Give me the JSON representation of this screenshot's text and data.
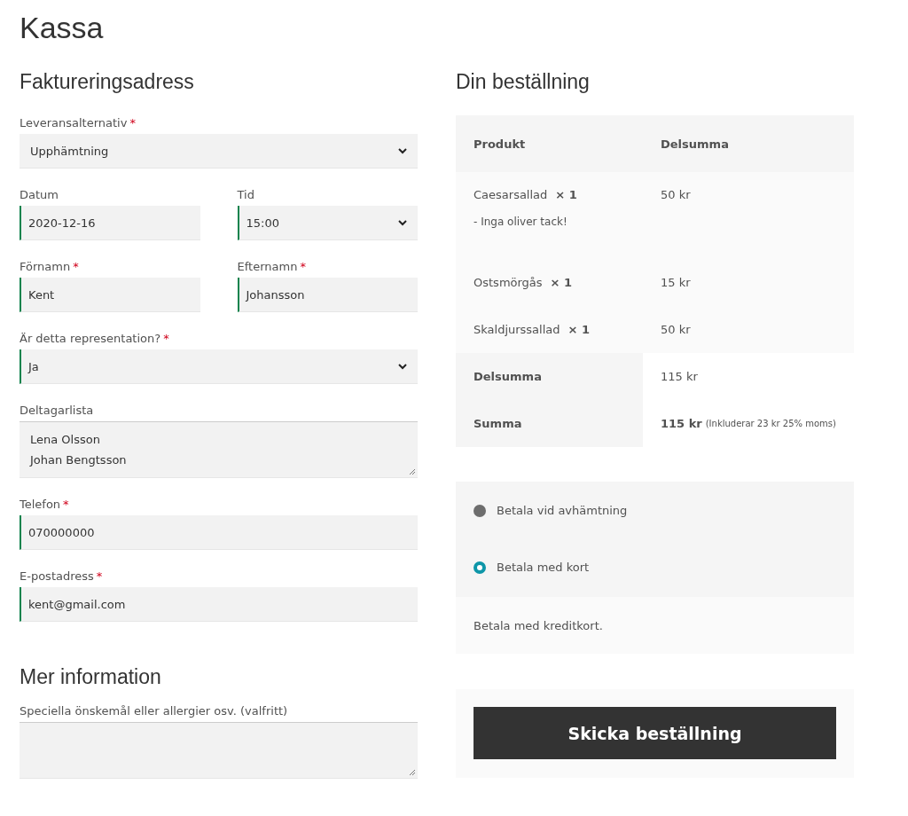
{
  "title": "Kassa",
  "billing": {
    "heading": "Faktureringsadress",
    "rows": [
      [
        {
          "label": "Leveransalternativ",
          "required_mark": "*",
          "kind": "select",
          "value": "Upphämtning",
          "validated": false
        }
      ],
      [
        {
          "label": "Datum",
          "kind": "input",
          "value": "2020-12-16",
          "validated": true
        },
        {
          "label": "Tid",
          "kind": "select",
          "value": "15:00",
          "validated": true
        }
      ],
      [
        {
          "label": "Förnamn",
          "required_mark": "*",
          "kind": "input",
          "value": "Kent",
          "validated": true
        },
        {
          "label": "Efternamn",
          "required_mark": "*",
          "kind": "input",
          "value": "Johansson",
          "validated": true
        }
      ],
      [
        {
          "label": "Är detta representation?",
          "required_mark": "*",
          "kind": "select",
          "value": "Ja",
          "validated": true
        }
      ],
      [
        {
          "label": "Deltagarlista",
          "kind": "textarea",
          "value": "Lena Olsson\nJohan Bengtsson",
          "validated": false
        }
      ],
      [
        {
          "label": "Telefon",
          "required_mark": "*",
          "kind": "input",
          "value": "070000000",
          "validated": true
        }
      ],
      [
        {
          "label": "E-postadress",
          "required_mark": "*",
          "kind": "input",
          "value": "kent@gmail.com",
          "validated": true
        }
      ]
    ]
  },
  "more": {
    "heading": "Mer information",
    "rows": [
      [
        {
          "label": "Speciella önskemål eller allergier osv. (valfritt)",
          "kind": "textarea",
          "validated": false
        }
      ]
    ]
  },
  "order": {
    "heading": "Din beställning",
    "columns": [
      "Produkt",
      "Delsumma"
    ],
    "items": [
      {
        "name": "Caesarsallad",
        "qty": "× 1",
        "note": "- Inga oliver tack!",
        "subtotal": "50 kr"
      },
      {
        "name": "Ostsmörgås",
        "qty": "× 1",
        "subtotal": "15 kr"
      },
      {
        "name": "Skaldjurssallad",
        "qty": "× 1",
        "subtotal": "50 kr"
      }
    ],
    "totals": [
      {
        "label": "Delsumma",
        "value": "115 kr",
        "strong": false
      },
      {
        "label": "Summa",
        "value": "115 kr",
        "strong": true,
        "note": "(Inkluderar 23 kr 25% moms)"
      }
    ]
  },
  "payment": {
    "methods": [
      {
        "label": "Betala vid avhämtning",
        "selected": false
      },
      {
        "label": "Betala med kort",
        "selected": true
      }
    ],
    "description": "Betala med kreditkort."
  },
  "submit": "Skicka beställning"
}
